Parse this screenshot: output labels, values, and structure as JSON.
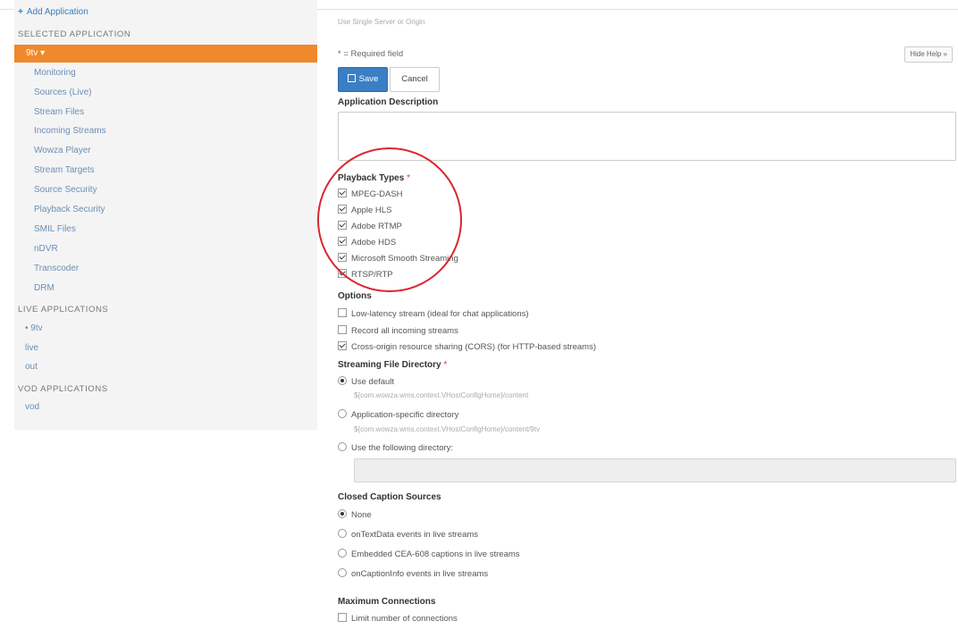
{
  "sidebar": {
    "add_application": "Add Application",
    "selected_heading": "SELECTED APPLICATION",
    "selected_app": "9tv ▾",
    "items": [
      {
        "label": "Monitoring"
      },
      {
        "label": "Sources (Live)"
      },
      {
        "label": "Stream Files"
      },
      {
        "label": "Incoming Streams"
      },
      {
        "label": "Wowza Player"
      },
      {
        "label": "Stream Targets"
      },
      {
        "label": "Source Security"
      },
      {
        "label": "Playback Security"
      },
      {
        "label": "SMIL Files"
      },
      {
        "label": "nDVR"
      },
      {
        "label": "Transcoder"
      },
      {
        "label": "DRM"
      }
    ],
    "live_heading": "LIVE APPLICATIONS",
    "live_apps": [
      {
        "label": "• 9tv"
      },
      {
        "label": "live"
      },
      {
        "label": "out"
      }
    ],
    "vod_heading": "VOD APPLICATIONS",
    "vod_apps": [
      {
        "label": "vod"
      }
    ]
  },
  "main": {
    "hint": "Use Single Server or Origin",
    "required_note": "* = Required field",
    "hide_help": "Hide Help »",
    "save_label": "Save",
    "cancel_label": "Cancel",
    "description_title": "Application Description",
    "playback_title": "Playback Types",
    "playback_types": [
      {
        "label": "MPEG-DASH",
        "checked": true
      },
      {
        "label": "Apple HLS",
        "checked": true
      },
      {
        "label": "Adobe RTMP",
        "checked": true
      },
      {
        "label": "Adobe HDS",
        "checked": true
      },
      {
        "label": "Microsoft Smooth Streaming",
        "checked": true
      },
      {
        "label": "RTSP/RTP",
        "checked": true
      }
    ],
    "options_title": "Options",
    "options": [
      {
        "label": "Low-latency stream (ideal for chat applications)",
        "checked": false
      },
      {
        "label": "Record all incoming streams",
        "checked": false
      },
      {
        "label": "Cross-origin resource sharing (CORS) (for HTTP-based streams)",
        "checked": true
      }
    ],
    "dir_title": "Streaming File Directory",
    "dir_default": "Use default",
    "dir_default_path": "${com.wowza.wms.context.VHostConfigHome}/content",
    "dir_app": "Application-specific directory",
    "dir_app_path": "${com.wowza.wms.context.VHostConfigHome}/content/9tv",
    "dir_custom": "Use the following directory:",
    "dir_selected": "default",
    "captions_title": "Closed Caption Sources",
    "captions": [
      {
        "label": "None",
        "checked": true
      },
      {
        "label": "onTextData events in live streams",
        "checked": false
      },
      {
        "label": "Embedded CEA-608 captions in live streams",
        "checked": false
      },
      {
        "label": "onCaptionInfo events in live streams",
        "checked": false
      }
    ],
    "maxconn_title": "Maximum Connections",
    "maxconn_limit": "Limit number of connections"
  },
  "colors": {
    "accent": "#f0892b",
    "link": "#6b8fb5",
    "primary_button": "#3a7fc4",
    "annotation": "#d9272e"
  }
}
